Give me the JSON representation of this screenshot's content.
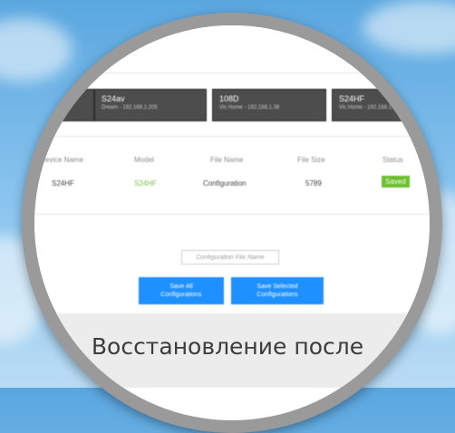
{
  "background": {
    "sky_color": "#6fb4e8",
    "ring_color": "#9a9a9a"
  },
  "devices": [
    {
      "name": "",
      "subtitle": ""
    },
    {
      "name": "S24av",
      "subtitle": "Dream - 192.168.1.205"
    },
    {
      "name": "108D",
      "subtitle": "Vic Home - 192.168.1.38"
    },
    {
      "name": "S24HF",
      "subtitle": "Vic Home - 192.168.1"
    }
  ],
  "table": {
    "headers": {
      "device_name": "Device Name",
      "model": "Model",
      "file_name": "File Name",
      "file_size": "File Size",
      "status": "Status"
    },
    "row": {
      "device_name": "S24HF",
      "model": "S24HF",
      "file_name": "Configuration",
      "file_size": "5789",
      "status": "Saved"
    }
  },
  "config_input": {
    "placeholder": "Configuration File Name",
    "value": ""
  },
  "buttons": {
    "save_all": [
      "Save All",
      "Configurations"
    ],
    "save_selected": [
      "Save Selected",
      "Configurations"
    ]
  },
  "colors": {
    "accent": "#1e90ff",
    "status_saved": "#6cbf2e",
    "model_link": "#7bc142",
    "tile": "#4d4d4d"
  },
  "caption": "Восстановление после"
}
